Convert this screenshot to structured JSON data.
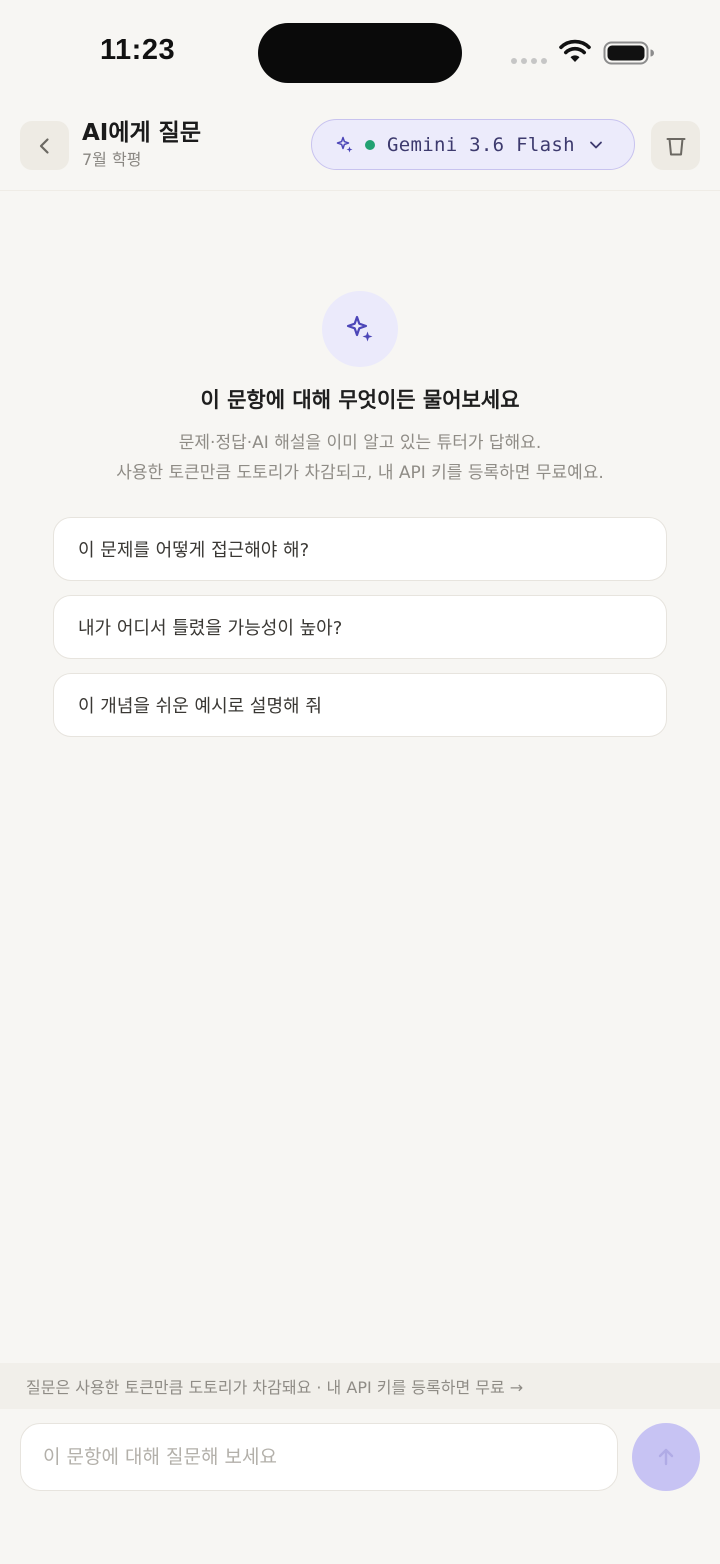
{
  "status_bar": {
    "time": "11:23"
  },
  "header": {
    "title": "AI에게 질문",
    "subtitle": "7월 학평",
    "model_selector": {
      "label": "Gemini 3.6 Flash",
      "status_color": "#22a172"
    },
    "icons": {
      "back": "chevron-left-icon",
      "trash": "trash-icon",
      "model": "sparkle-icon",
      "dropdown": "chevron-down-icon"
    }
  },
  "hero": {
    "icon": "sparkle-icon",
    "heading": "이 문항에 대해 무엇이든 물어보세요",
    "description_line1": "문제·정답·AI 해설을 이미 알고 있는 튜터가 답해요.",
    "description_line2": "사용한 토큰만큼 도토리가 차감되고, 내 API 키를 등록하면 무료예요."
  },
  "suggestions": [
    {
      "label": "이 문제를 어떻게 접근해야 해?"
    },
    {
      "label": "내가 어디서 틀렸을 가능성이 높아?"
    },
    {
      "label": "이 개념을 쉬운 예시로 설명해 줘"
    }
  ],
  "notice": {
    "text": "질문은 사용한 토큰만큼 도토리가 차감돼요 · 내 API 키를 등록하면 무료 →"
  },
  "composer": {
    "placeholder": "이 문항에 대해 질문해 보세요",
    "value": "",
    "send_icon": "arrow-up-icon"
  },
  "colors": {
    "accent": "#5b55c9",
    "accent_light": "#ecebfb",
    "send_disabled": "#c7c3f3",
    "background": "#f7f6f3"
  }
}
